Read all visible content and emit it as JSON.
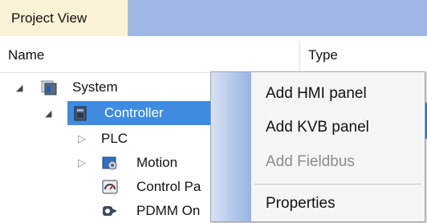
{
  "tabs": {
    "project_view": "Project View"
  },
  "columns": {
    "name": "Name",
    "type": "Type"
  },
  "tree": {
    "items": [
      {
        "label": "System",
        "icon": "system-icon",
        "expanded": true
      },
      {
        "label": "Controller",
        "icon": "controller-icon",
        "expanded": true,
        "selected": true
      },
      {
        "label": "PLC",
        "expanded": false
      },
      {
        "label": "Motion",
        "icon": "motion-icon",
        "expanded": false
      },
      {
        "label": "Control Pa",
        "icon": "control-panel-icon"
      },
      {
        "label": "PDMM On",
        "icon": "pdmm-icon"
      }
    ]
  },
  "context_menu": {
    "items": [
      {
        "label": "Add HMI panel",
        "enabled": true
      },
      {
        "label": "Add KVB panel",
        "enabled": true
      },
      {
        "label": "Add Fieldbus",
        "enabled": false
      },
      {
        "label": "Properties",
        "enabled": true
      }
    ]
  },
  "colors": {
    "tab_active": "#fbf1d6",
    "tabstrip": "#9fb6e5",
    "selection": "#3f8be0",
    "menu_bg": "#f5f5f5",
    "disabled_text": "#8c8c8c"
  }
}
